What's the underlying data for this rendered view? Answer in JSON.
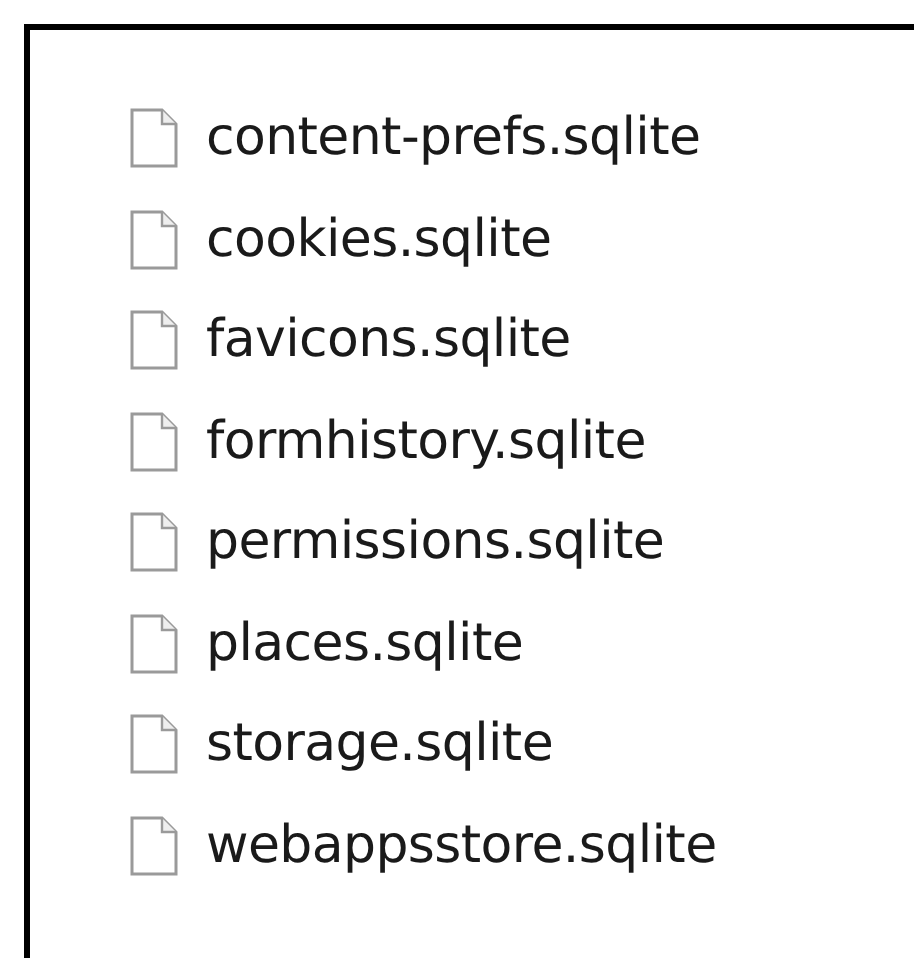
{
  "files": [
    {
      "name": "content-prefs.sqlite"
    },
    {
      "name": "cookies.sqlite"
    },
    {
      "name": "favicons.sqlite"
    },
    {
      "name": "formhistory.sqlite"
    },
    {
      "name": "permissions.sqlite"
    },
    {
      "name": "places.sqlite"
    },
    {
      "name": "storage.sqlite"
    },
    {
      "name": "webappsstore.sqlite"
    }
  ]
}
